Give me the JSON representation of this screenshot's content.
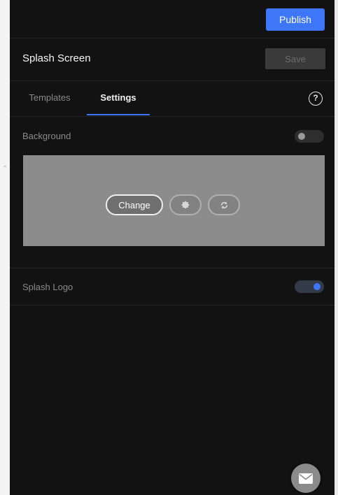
{
  "header": {
    "publish_label": "Publish"
  },
  "title_bar": {
    "title": "Splash Screen",
    "save_label": "Save"
  },
  "tabs": [
    {
      "label": "Templates",
      "active": false
    },
    {
      "label": "Settings",
      "active": true
    }
  ],
  "help": {
    "glyph": "?",
    "icon": "help-circle-icon"
  },
  "background_section": {
    "label": "Background",
    "enabled": false,
    "preview_color": "#8c8c8c",
    "change_label": "Change",
    "actions": [
      {
        "icon": "gear-icon"
      },
      {
        "icon": "refresh-icon"
      }
    ]
  },
  "splash_logo_section": {
    "label": "Splash Logo",
    "enabled": true
  },
  "chat": {
    "icon": "envelope-icon"
  },
  "colors": {
    "accent": "#3d76f7",
    "panel_bg": "#121212",
    "muted_text": "#8a8a8a"
  }
}
